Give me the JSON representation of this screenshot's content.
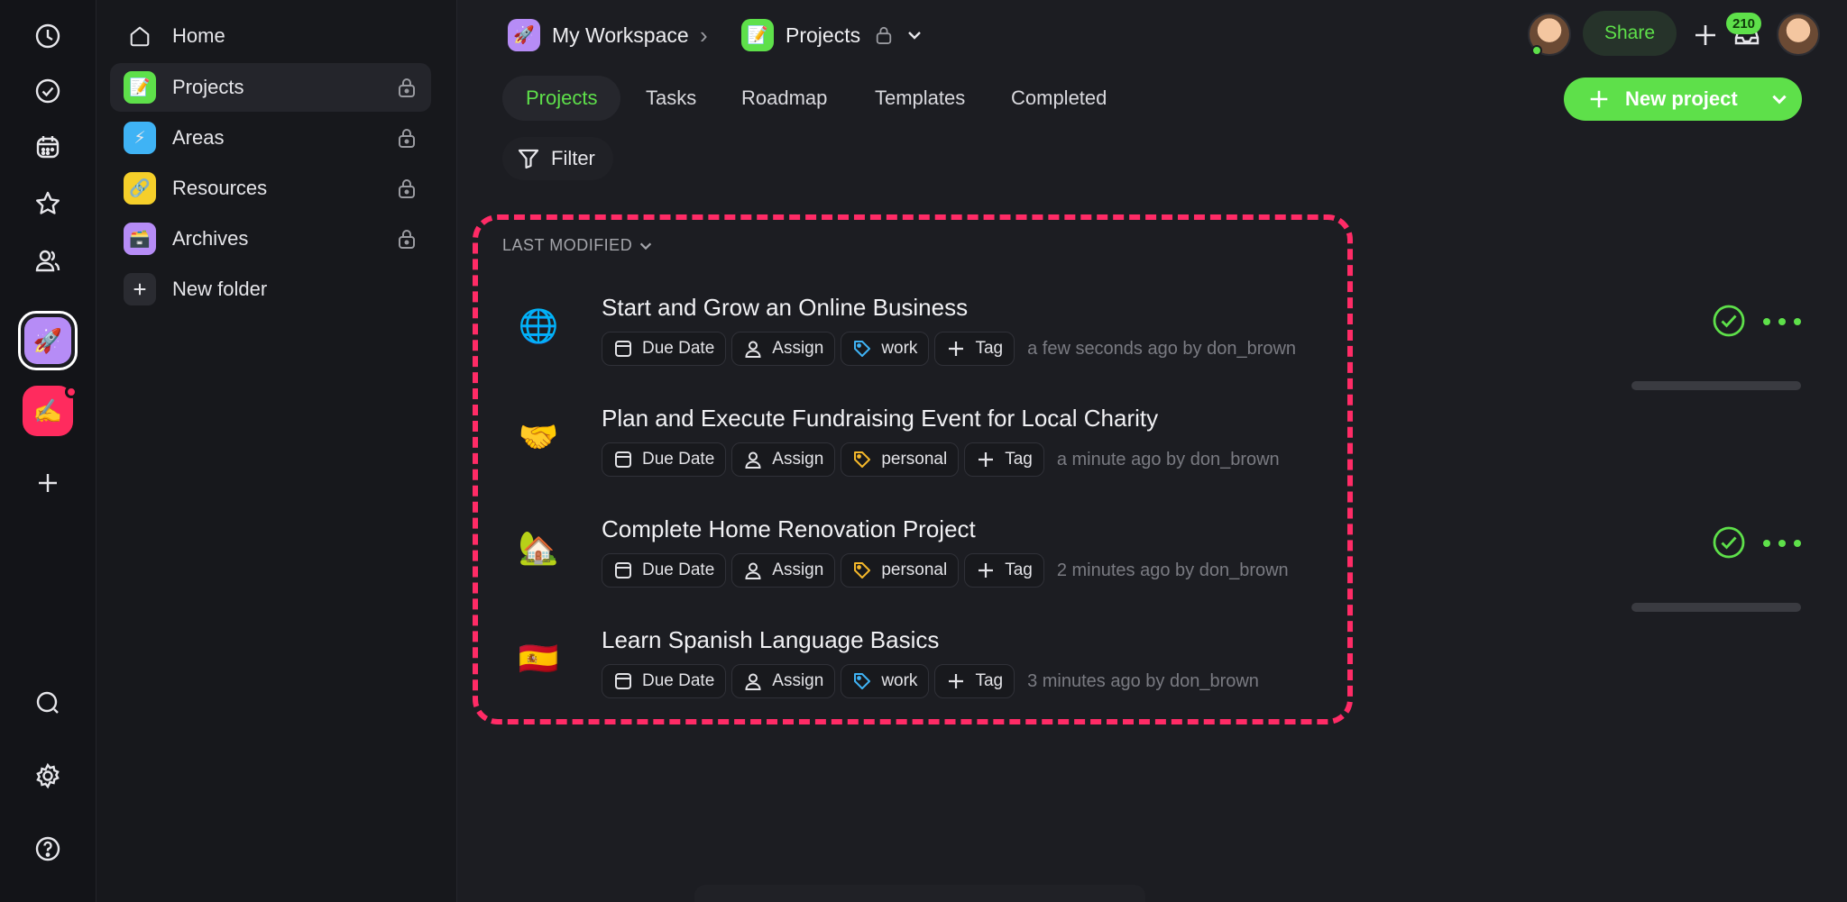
{
  "breadcrumb": {
    "workspace": "My Workspace",
    "workspace_emoji": "🚀",
    "separator": "›",
    "page": "Projects",
    "page_emoji": "📝"
  },
  "header": {
    "share_label": "Share",
    "notification_count": "210",
    "new_project_label": "New project"
  },
  "tabs": [
    {
      "label": "Projects",
      "active": true
    },
    {
      "label": "Tasks",
      "active": false
    },
    {
      "label": "Roadmap",
      "active": false
    },
    {
      "label": "Templates",
      "active": false
    },
    {
      "label": "Completed",
      "active": false
    }
  ],
  "filter_label": "Filter",
  "sort_label": "LAST MODIFIED",
  "sidebar": {
    "items": [
      {
        "label": "Home",
        "emoji": "",
        "color": "",
        "locked": false
      },
      {
        "label": "Projects",
        "emoji": "📝",
        "color": "#5ee04a",
        "locked": true
      },
      {
        "label": "Areas",
        "emoji": "⚡",
        "color": "#3fb3f5",
        "locked": true
      },
      {
        "label": "Resources",
        "emoji": "🔗",
        "color": "#f5cf2a",
        "locked": true
      },
      {
        "label": "Archives",
        "emoji": "🗃️",
        "color": "#b68cf6",
        "locked": true
      }
    ],
    "new_folder_label": "New folder"
  },
  "chip_labels": {
    "due_date": "Due Date",
    "assign": "Assign",
    "add_tag": "Tag"
  },
  "projects": [
    {
      "emoji": "🌐",
      "title": "Start and Grow an Online Business",
      "tag": "work",
      "tag_color": "#3fb3f5",
      "modified": "a few seconds ago by don_brown",
      "status": "check"
    },
    {
      "emoji": "🤝",
      "title": "Plan and Execute Fundraising Event for Local Charity",
      "tag": "personal",
      "tag_color": "#f5b82a",
      "modified": "a minute ago by don_brown",
      "status": "progress"
    },
    {
      "emoji": "🏡",
      "title": "Complete Home Renovation Project",
      "tag": "personal",
      "tag_color": "#f5b82a",
      "modified": "2 minutes ago by don_brown",
      "status": "check"
    },
    {
      "emoji": "🇪🇸",
      "title": "Learn Spanish Language Basics",
      "tag": "work",
      "tag_color": "#3fb3f5",
      "modified": "3 minutes ago by don_brown",
      "status": "progress"
    }
  ],
  "colors": {
    "accent": "#5ee04a",
    "highlight_border": "#ff2b66",
    "workspace_badge": "#b68cf6",
    "second_workspace": "#ff2b5e"
  }
}
